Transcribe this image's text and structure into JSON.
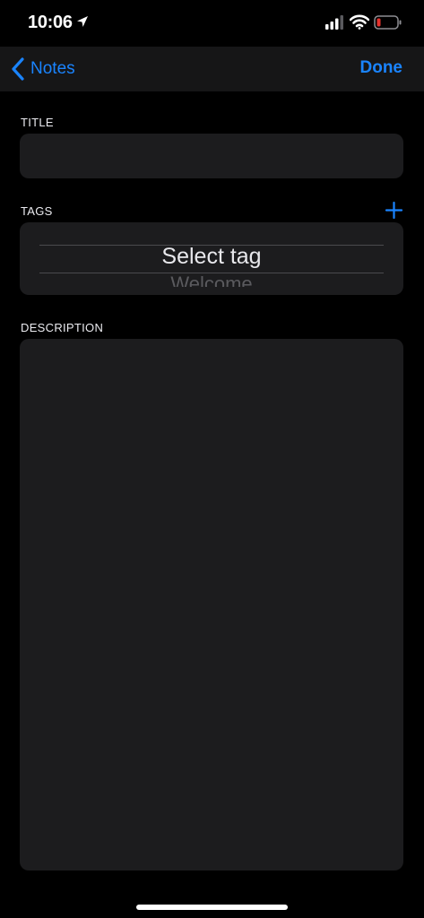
{
  "status_bar": {
    "time": "10:06",
    "icons": [
      "location-arrow-icon",
      "cellular-signal-icon",
      "wifi-icon",
      "battery-icon"
    ],
    "battery_color": "#e5322d"
  },
  "nav": {
    "back_label": "Notes",
    "done_label": "Done",
    "accent_color": "#1a84ff"
  },
  "form": {
    "title_label": "TITLE",
    "title_value": "",
    "tags_label": "TAGS",
    "add_tag_icon": "plus-icon",
    "tag_picker": {
      "selected": "Select tag",
      "next": "Welcome"
    },
    "description_label": "DESCRIPTION",
    "description_value": ""
  }
}
